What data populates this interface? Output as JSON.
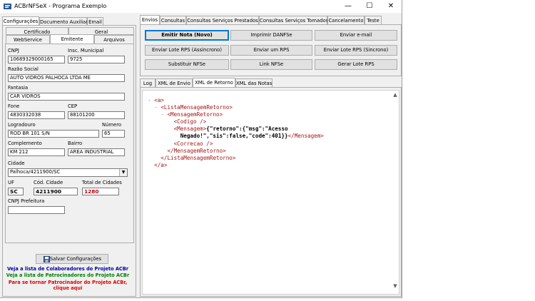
{
  "window": {
    "title": "ACBrNFSeX - Programa Exemplo",
    "controls": {
      "minimize": "—",
      "maximize": "☐",
      "close": "✕"
    }
  },
  "left": {
    "top_tabs": [
      "Configurações",
      "Documento Auxiliar",
      "Email"
    ],
    "sub_tabs_row1": [
      "Certificado",
      "Geral"
    ],
    "sub_tabs_row2": [
      "WebService",
      "Emitente",
      "Arquivos"
    ],
    "fields": {
      "cnpj_label": "CNPJ",
      "cnpj": "10689329000165",
      "im_label": "Insc. Municipal",
      "im": "9725",
      "razao_label": "Razão Social",
      "razao": "AUTO VIDROS PALHOCA LTDA ME",
      "fantasia_label": "Fantasia",
      "fantasia": "CAR VIDROS",
      "fone_label": "Fone",
      "fone": "4830332038",
      "cep_label": "CEP",
      "cep": "88101200",
      "logradouro_label": "Logradouro",
      "logradouro": "ROD BR 101 S/N",
      "numero_label": "Número",
      "numero": "65",
      "complemento_label": "Complemento",
      "complemento": "KM 212",
      "bairro_label": "Bairro",
      "bairro": "AREA INDUSTRIAL",
      "cidade_label": "Cidade",
      "cidade": "Palhoca/4211900/SC",
      "uf_label": "UF",
      "uf": "SC",
      "cod_cidade_label": "Cód. Cidade",
      "cod_cidade": "4211900",
      "total_cidades_label": "Total de Cidades",
      "total_cidades": "1280",
      "cnpj_prefeitura_label": "CNPJ Prefeitura",
      "cnpj_prefeitura": ""
    },
    "save_button": "Salvar Configurações",
    "links": {
      "colaboradores": "Veja a lista de Colaboradores do Projeto ACBr",
      "patrocinadores": "Veja a lista de Patrocinadores do Projeto ACBr",
      "tornar_line1": "Para se tornar Patrocinador do Projeto ACBr,",
      "tornar_line2": "clique aqui"
    },
    "colors": {
      "blue": "#0000a0",
      "green": "#008000",
      "red": "#e00000"
    }
  },
  "right": {
    "top_tabs": [
      "Envios",
      "Consultas",
      "Consultas Serviços Prestados",
      "Consultas Serviços Tomados",
      "Cancelamento",
      "Teste"
    ],
    "buttons": [
      [
        "Emitir Nota (Novo)",
        "Imprimir DANFSe",
        "Enviar e-mail"
      ],
      [
        "Enviar Lote RPS (Assincrono)",
        "Enviar um RPS",
        "Enviar Lote RPS (Sincrono)"
      ],
      [
        "Substituir NFSe",
        "Link NFSe",
        "Gerar Lote RPS"
      ]
    ],
    "log_tabs": [
      "Log",
      "XML de Envio",
      "XML de Retorno",
      "XML das Notas"
    ],
    "xml_lines": [
      {
        "indent": "",
        "marker": "- ",
        "text": "<a>",
        "value": "",
        "close": ""
      },
      {
        "indent": "  ",
        "marker": "- ",
        "text": "<ListaMensagemRetorno>",
        "value": "",
        "close": ""
      },
      {
        "indent": "    ",
        "marker": "- ",
        "text": "<MensagemRetorno>",
        "value": "",
        "close": ""
      },
      {
        "indent": "        ",
        "marker": "",
        "text": "<Codigo />",
        "value": "",
        "close": ""
      },
      {
        "indent": "        ",
        "marker": "",
        "text": "<Mensagem>",
        "value": "{\"retorno\":{\"msg\":\"Acesso",
        "close": ""
      },
      {
        "indent": "          ",
        "marker": "",
        "text": "",
        "value": "Negado!\",\"sis\":false,\"code\":401}}",
        "close": "</Mensagem>"
      },
      {
        "indent": "        ",
        "marker": "",
        "text": "<Correcao />",
        "value": "",
        "close": ""
      },
      {
        "indent": "      ",
        "marker": "",
        "text": "</MensagemRetorno>",
        "value": "",
        "close": ""
      },
      {
        "indent": "    ",
        "marker": "",
        "text": "</ListaMensagemRetorno>",
        "value": "",
        "close": ""
      },
      {
        "indent": "  ",
        "marker": "",
        "text": "</a>",
        "value": "",
        "close": ""
      }
    ]
  }
}
